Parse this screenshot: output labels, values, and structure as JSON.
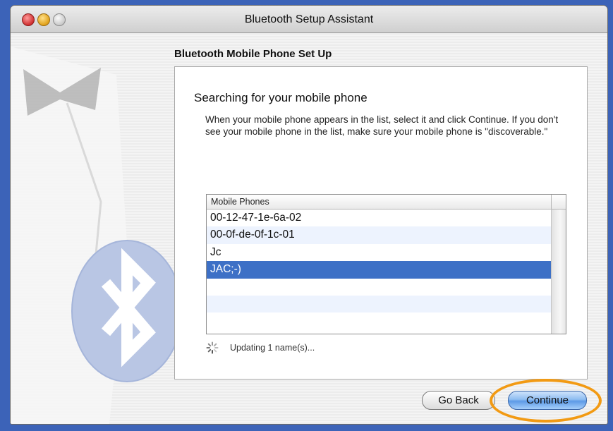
{
  "window": {
    "title": "Bluetooth Setup Assistant"
  },
  "section_title": "Bluetooth Mobile Phone Set Up",
  "panel": {
    "heading": "Searching for your mobile phone",
    "description": "When your mobile phone appears in the list, select it and click Continue. If you don't see your mobile phone in the list, make sure your mobile phone is \"discoverable.\""
  },
  "list": {
    "column_header": "Mobile Phones",
    "items": [
      {
        "label": "00-12-47-1e-6a-02",
        "selected": false
      },
      {
        "label": "00-0f-de-0f-1c-01",
        "selected": false
      },
      {
        "label": "Jc",
        "selected": false
      },
      {
        "label": "JAC;-)",
        "selected": true
      },
      {
        "label": "",
        "selected": false
      },
      {
        "label": "",
        "selected": false
      },
      {
        "label": "",
        "selected": false
      }
    ]
  },
  "status": {
    "text": "Updating 1 name(s)...",
    "icon": "progress-spinner-icon"
  },
  "buttons": {
    "back_label": "Go Back",
    "continue_label": "Continue"
  },
  "colors": {
    "desktop": "#3c63b8",
    "selection": "#3d70c6",
    "highlight_ring": "#f29a13"
  }
}
